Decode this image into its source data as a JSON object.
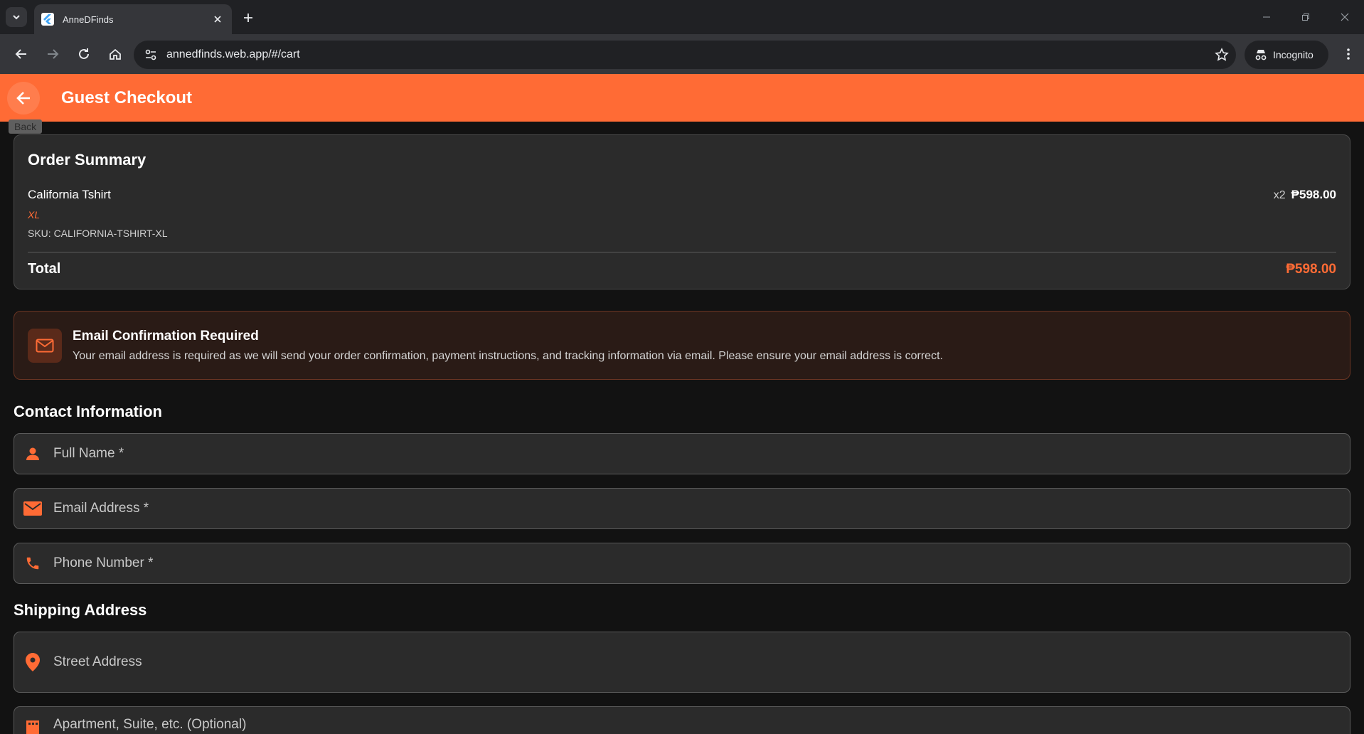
{
  "browser": {
    "tab_title": "AnneDFinds",
    "url": "annedfinds.web.app/#/cart",
    "incognito_label": "Incognito"
  },
  "app": {
    "title": "Guest Checkout",
    "back_tooltip": "Back"
  },
  "order_summary": {
    "heading": "Order Summary",
    "items": [
      {
        "name": "California Tshirt",
        "variant": "XL",
        "sku": "SKU: CALIFORNIA-TSHIRT-XL",
        "quantity": "x2",
        "price": "₱598.00"
      }
    ],
    "total_label": "Total",
    "total_value": "₱598.00"
  },
  "notice": {
    "title": "Email Confirmation Required",
    "body": "Your email address is required as we will send your order confirmation, payment instructions, and tracking information via email. Please ensure your email address is correct."
  },
  "contact": {
    "heading": "Contact Information",
    "full_name": "Full Name *",
    "email": "Email Address *",
    "phone": "Phone Number *"
  },
  "shipping": {
    "heading": "Shipping Address",
    "street": "Street Address",
    "apartment": "Apartment, Suite, etc. (Optional)"
  },
  "colors": {
    "accent": "#ff6b35",
    "background": "#121212",
    "card": "#2b2b2b"
  }
}
